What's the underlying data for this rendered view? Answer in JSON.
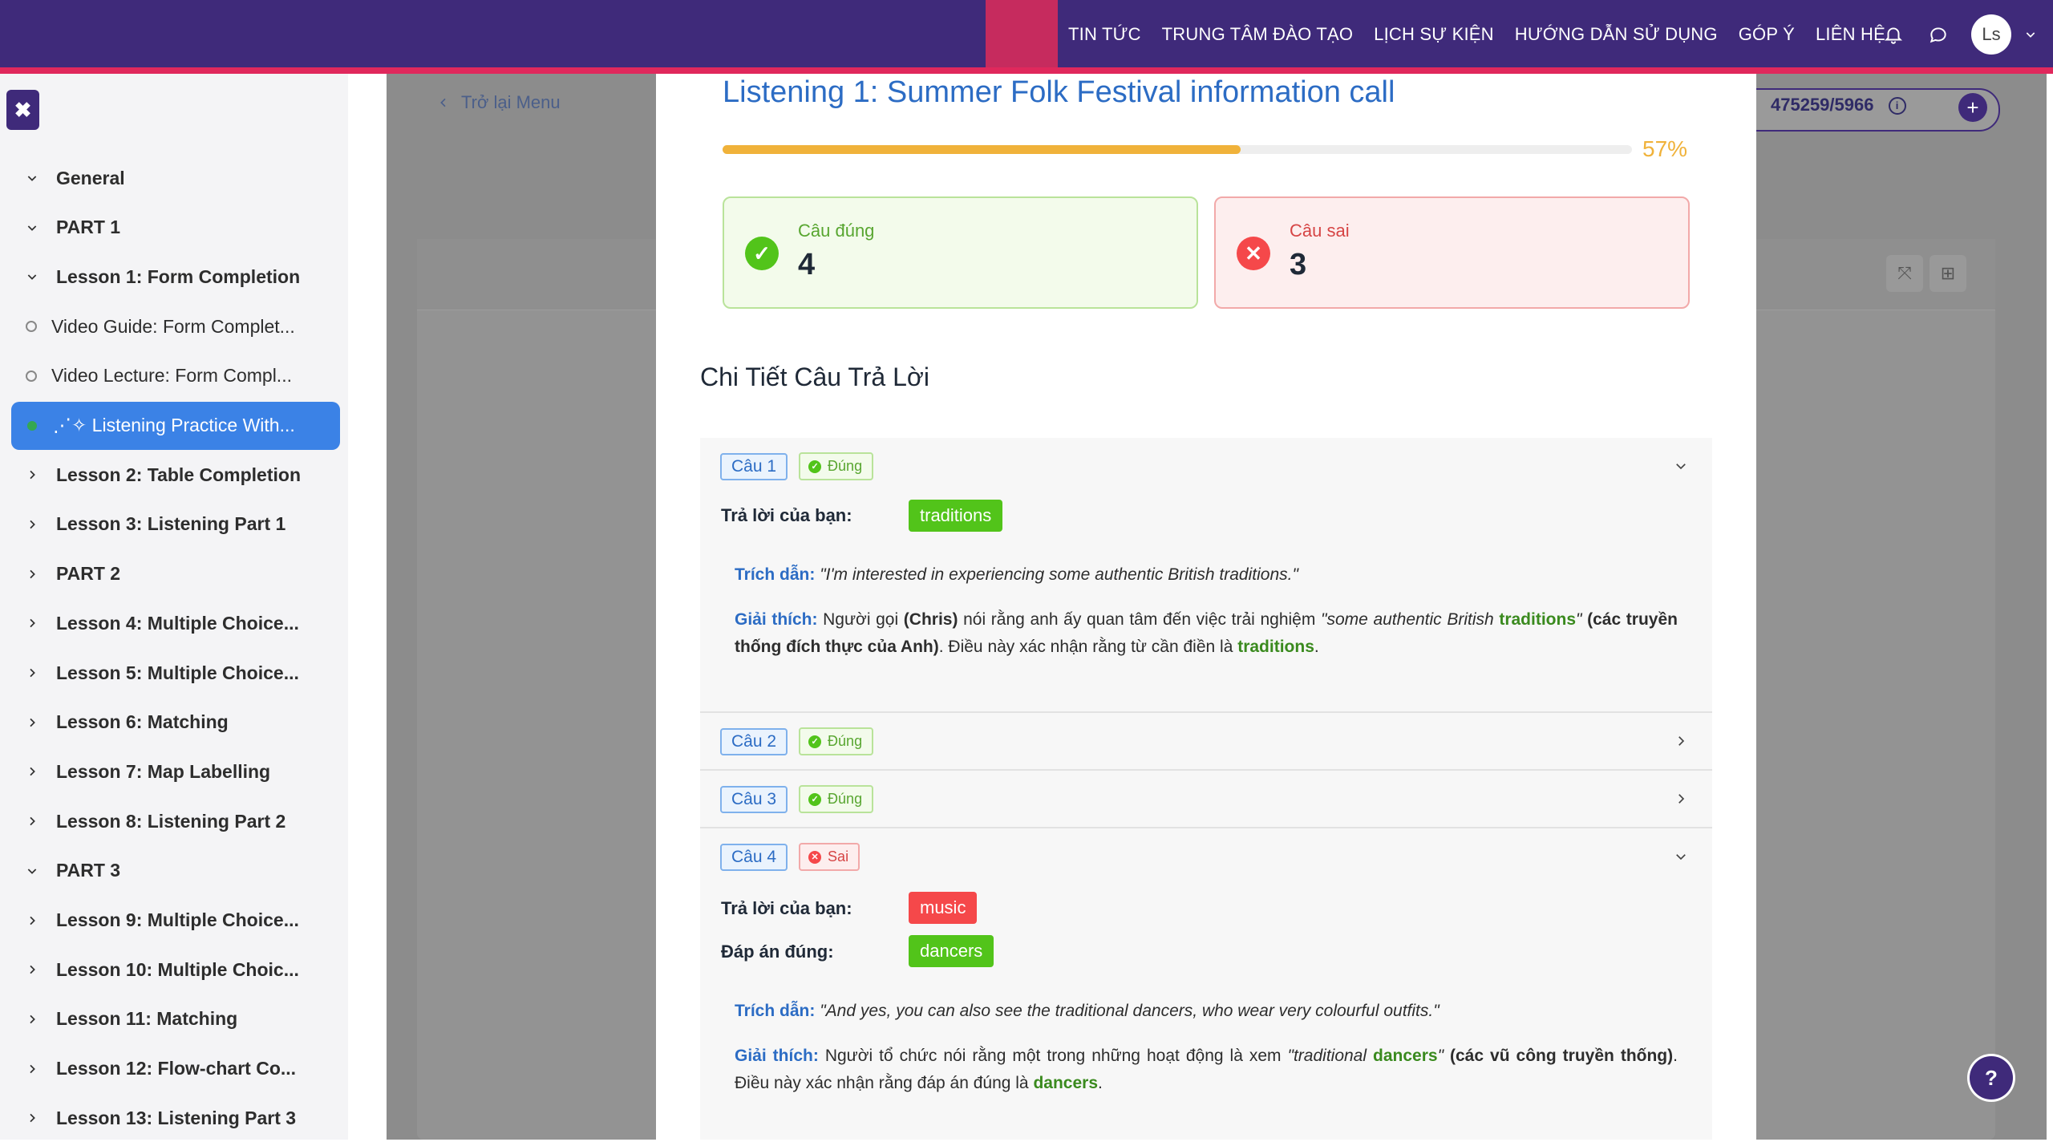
{
  "nav": {
    "items": [
      "TIN TỨC",
      "TRUNG TÂM ĐÀO TẠO",
      "LỊCH SỰ KIỆN",
      "HƯỚNG DẪN SỬ DỤNG",
      "GÓP Ý",
      "LIÊN HỆ"
    ],
    "avatar_initials": "Ls",
    "icons": [
      "bell-icon",
      "chat-icon",
      "chevron-down-icon"
    ]
  },
  "sidebar": {
    "close_icon": "close-icon",
    "items": [
      {
        "label": "General",
        "kind": "section",
        "icon": "chevron-down-icon"
      },
      {
        "label": "PART 1",
        "kind": "section",
        "icon": "chevron-down-icon"
      },
      {
        "label": "Lesson 1: Form Completion",
        "kind": "section",
        "icon": "chevron-down-icon"
      },
      {
        "label": "Video Guide: Form Complet...",
        "kind": "sub",
        "icon": "circle-icon"
      },
      {
        "label": "Video Lecture: Form Compl...",
        "kind": "sub",
        "icon": "circle-icon"
      },
      {
        "label": "⋰✧ Listening Practice With...",
        "kind": "active",
        "icon": "dot-icon"
      },
      {
        "label": "Lesson 2: Table Completion",
        "kind": "section",
        "icon": "chevron-right-icon"
      },
      {
        "label": "Lesson 3: Listening Part 1",
        "kind": "section",
        "icon": "chevron-right-icon"
      },
      {
        "label": "PART 2",
        "kind": "section",
        "icon": "chevron-right-icon"
      },
      {
        "label": "Lesson 4: Multiple Choice...",
        "kind": "section",
        "icon": "chevron-right-icon"
      },
      {
        "label": "Lesson 5: Multiple Choice...",
        "kind": "section",
        "icon": "chevron-right-icon"
      },
      {
        "label": "Lesson 6: Matching",
        "kind": "section",
        "icon": "chevron-right-icon"
      },
      {
        "label": "Lesson 7: Map Labelling",
        "kind": "section",
        "icon": "chevron-right-icon"
      },
      {
        "label": "Lesson 8: Listening Part 2",
        "kind": "section",
        "icon": "chevron-right-icon"
      },
      {
        "label": "PART 3",
        "kind": "section",
        "icon": "chevron-down-icon"
      },
      {
        "label": "Lesson 9: Multiple Choice...",
        "kind": "section",
        "icon": "chevron-right-icon"
      },
      {
        "label": "Lesson 10: Multiple Choic...",
        "kind": "section",
        "icon": "chevron-right-icon"
      },
      {
        "label": "Lesson 11: Matching",
        "kind": "section",
        "icon": "chevron-right-icon"
      },
      {
        "label": "Lesson 12: Flow-chart Co...",
        "kind": "section",
        "icon": "chevron-right-icon"
      },
      {
        "label": "Lesson 13: Listening Part 3",
        "kind": "section",
        "icon": "chevron-right-icon"
      }
    ]
  },
  "main": {
    "back_label": "Trở lại Menu",
    "credits": "475259/5966"
  },
  "modal": {
    "title": "Listening 1: Summer Folk Festival information call",
    "progress_percent": 57,
    "progress_label": "57%",
    "correct_label": "Câu đúng",
    "correct_count": "4",
    "wrong_label": "Câu sai",
    "wrong_count": "3",
    "details_title": "Chi Tiết Câu Trả Lời",
    "your_answer_label": "Trả lời của bạn:",
    "correct_answer_label": "Đáp án đúng:",
    "quote_label": "Trích dẫn:",
    "explain_label": "Giải thích:",
    "questions": [
      {
        "tag": "Câu 1",
        "status": "Đúng",
        "your_answer": "traditions",
        "quote": "\"I'm interested in experiencing some authentic British traditions.\"",
        "explain": {
          "a": "Người gọi ",
          "b": "(Chris)",
          "c": " nói rằng anh ấy quan tâm đến việc trải nghiệm ",
          "d": "\"some authentic British ",
          "kw": "traditions",
          "e": "\"",
          "f": " (các truyền thống đích thực của Anh)",
          "g": ". Điều này xác nhận rằng từ cần điền là ",
          "kw2": "traditions",
          "h": "."
        }
      },
      {
        "tag": "Câu 2",
        "status": "Đúng"
      },
      {
        "tag": "Câu 3",
        "status": "Đúng"
      },
      {
        "tag": "Câu 4",
        "status": "Sai",
        "your_answer": "music",
        "correct_answer": "dancers",
        "quote": "\"And yes, you can also see the traditional dancers, who wear very colourful outfits.\"",
        "explain": {
          "a": "Người tổ chức nói rằng một trong những hoạt động là xem ",
          "d": "\"traditional ",
          "kw": "dancers",
          "e": "\"",
          "f": " (các vũ công truyền thống)",
          "g": ". Điều này xác nhận rằng đáp án đúng là ",
          "kw2": "dancers",
          "h": "."
        }
      }
    ]
  },
  "help_label": "?"
}
